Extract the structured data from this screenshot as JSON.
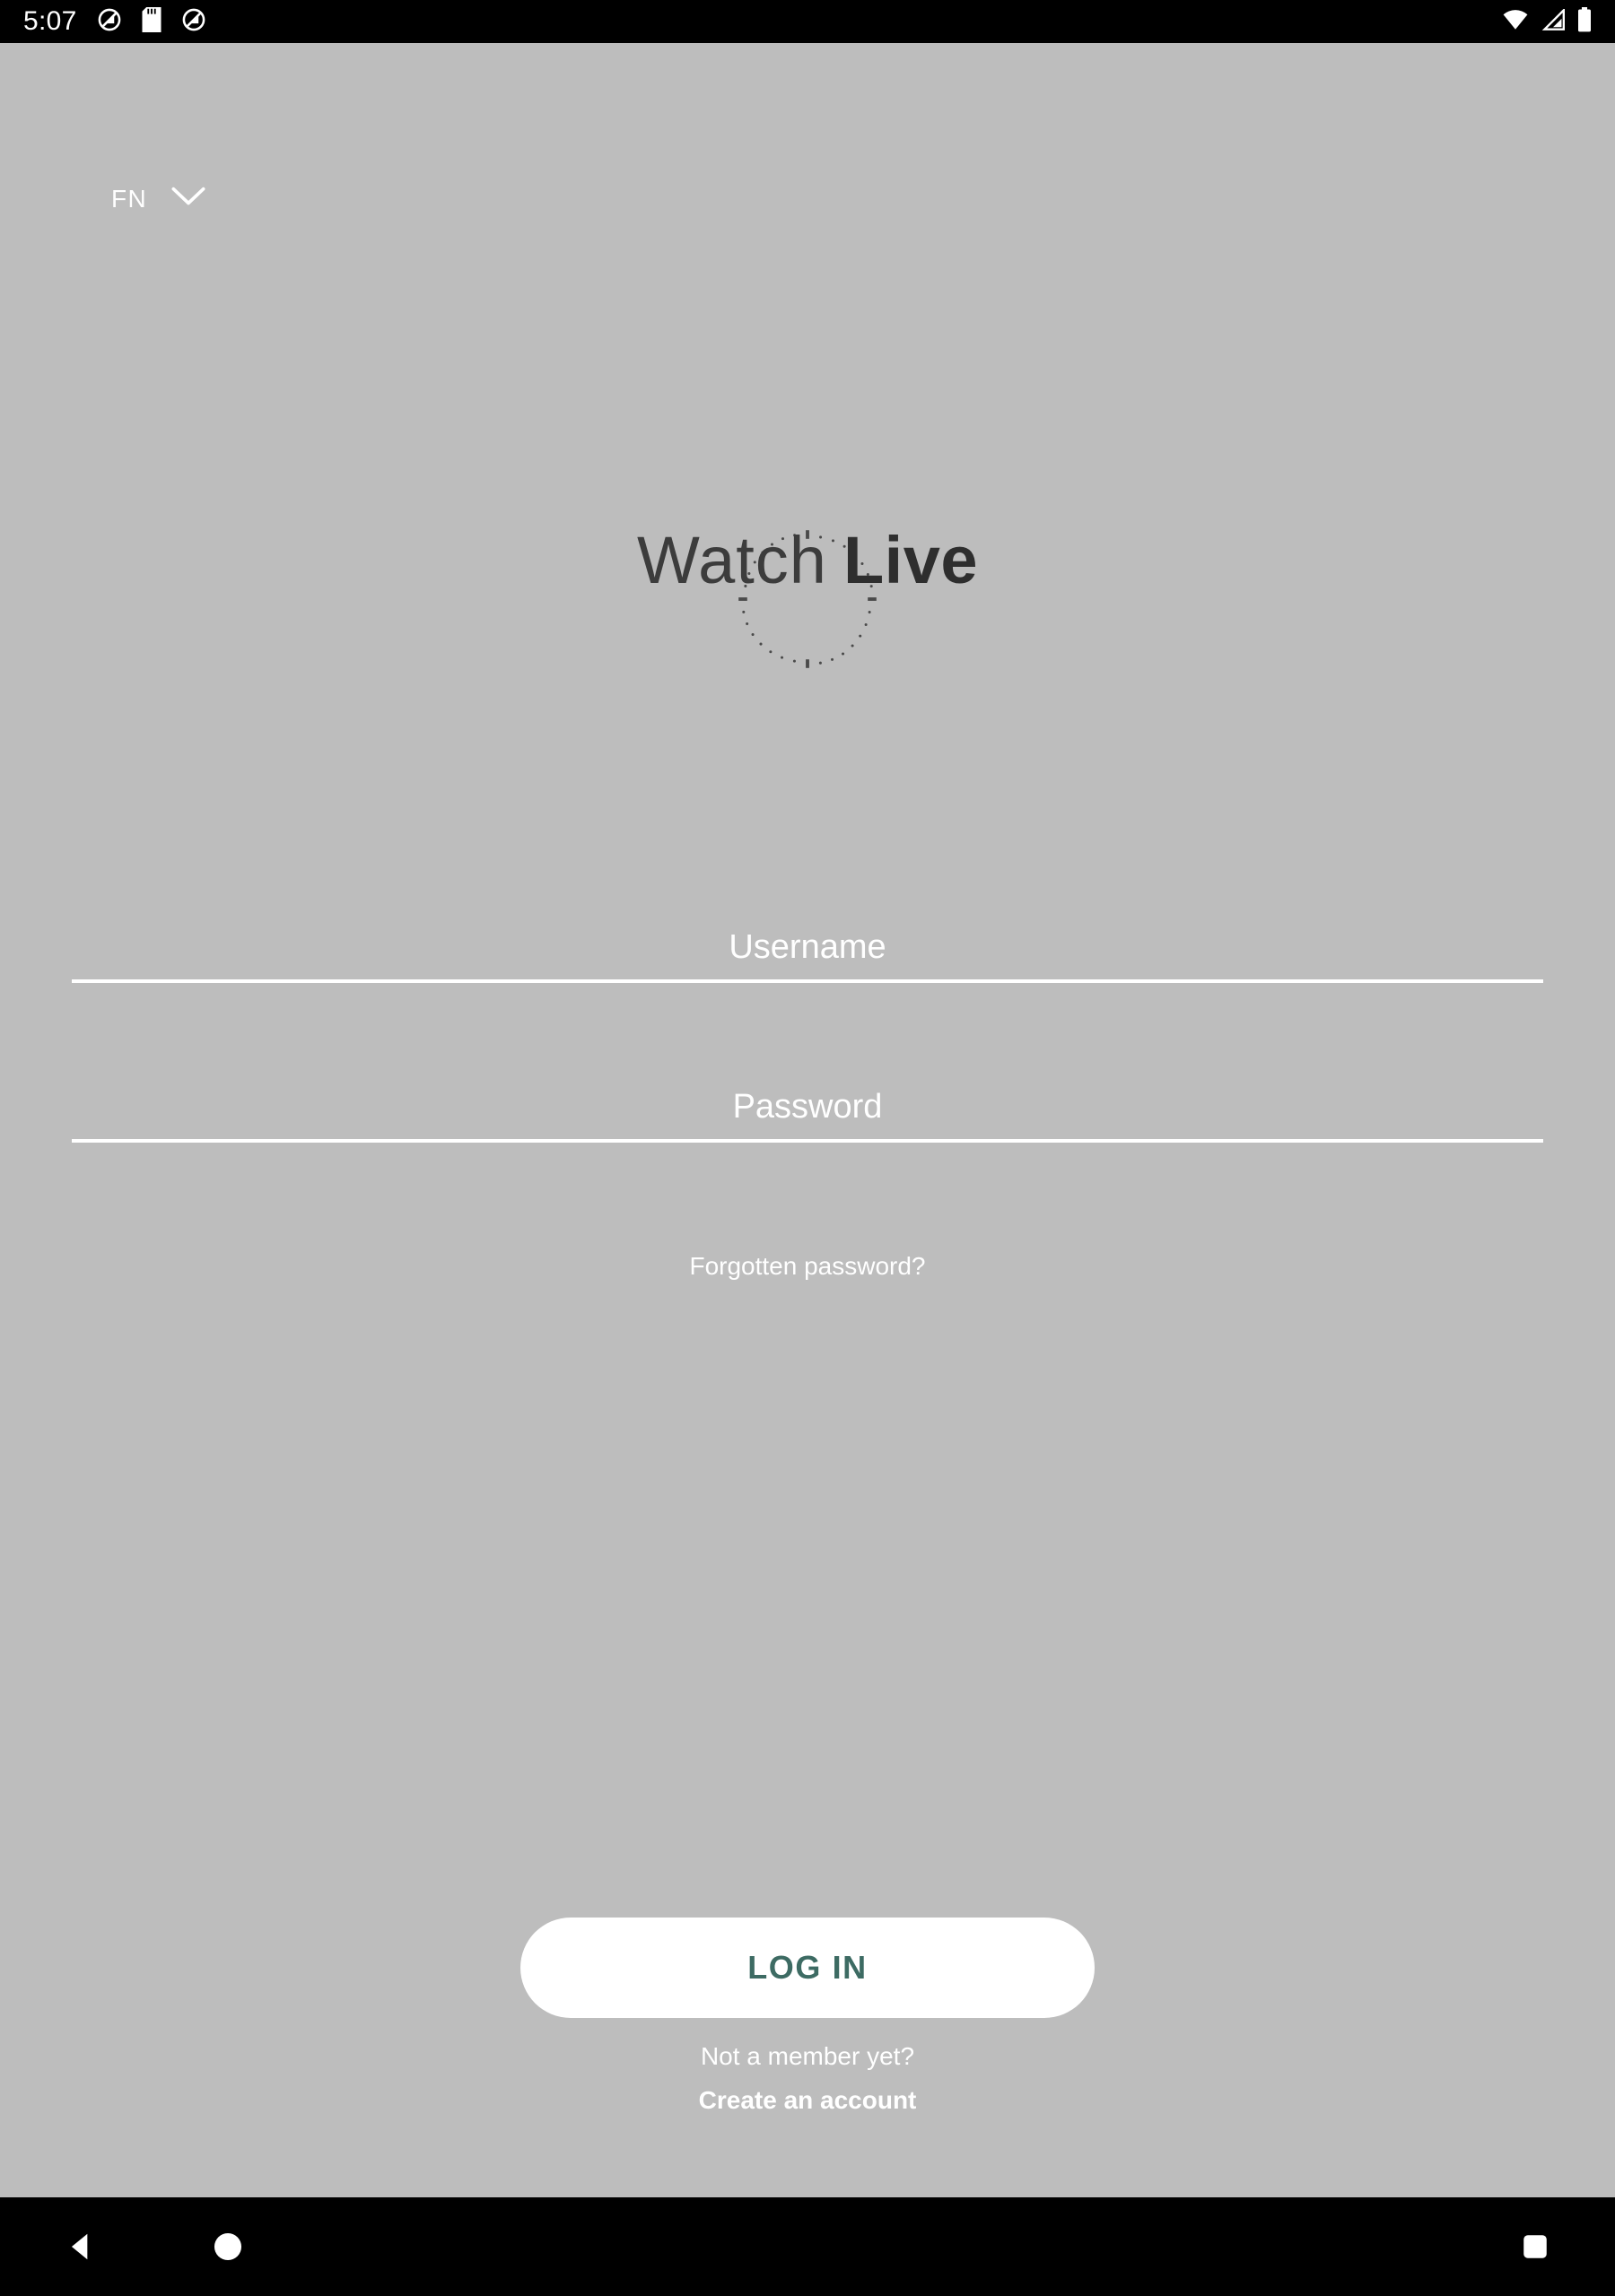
{
  "status_bar": {
    "clock": "5:07",
    "left_icons": [
      "no-signal-icon",
      "sd-card-icon",
      "no-signal-icon"
    ],
    "right_icons": [
      "wifi-icon",
      "cellular-signal-icon",
      "battery-icon"
    ],
    "background_color": "#000000",
    "foreground_color": "#ffffff"
  },
  "app": {
    "background_color": "#bdbdbd",
    "language_selector": {
      "code": "FN",
      "icon": "chevron-down-icon"
    },
    "logo": {
      "text_light": "Watch",
      "text_bold": "Live",
      "full_text": "Watch Live",
      "color_light": "#3c3c3c",
      "color_bold": "#2e2e2e",
      "dial_icon": "watch-dial-dotted-circle"
    },
    "form": {
      "username": {
        "placeholder": "Username",
        "value": ""
      },
      "password": {
        "placeholder": "Password",
        "value": ""
      },
      "forgot_password_label": "Forgotten password?"
    },
    "login_button": {
      "label": "LOG IN",
      "text_color": "#3d6b63",
      "background_color": "#ffffff"
    },
    "signup": {
      "question": "Not a member yet?",
      "link_label": "Create an account"
    }
  },
  "nav_bar": {
    "background_color": "#000000",
    "back_icon": "triangle-back-icon",
    "home_icon": "circle-home-icon",
    "recents_icon": "square-recents-icon"
  }
}
